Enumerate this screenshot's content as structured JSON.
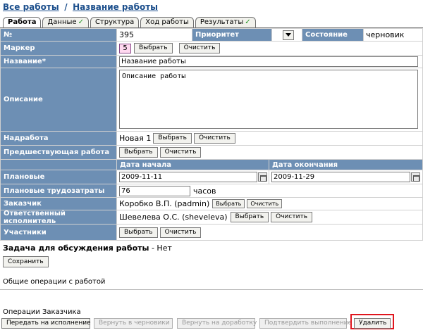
{
  "breadcrumb": {
    "all_works": "Все работы",
    "separator": "/",
    "current": "Название работы"
  },
  "tabs": [
    {
      "label": "Работа",
      "active": true,
      "check": false
    },
    {
      "label": "Данные",
      "active": false,
      "check": true
    },
    {
      "label": "Структура",
      "active": false,
      "check": false
    },
    {
      "label": "Ход работы",
      "active": false,
      "check": false
    },
    {
      "label": "Результаты",
      "active": false,
      "check": true
    }
  ],
  "check_mark": "✓",
  "form": {
    "number": {
      "label": "№",
      "value": "395"
    },
    "priority": {
      "label": "Приоритет",
      "selected": ""
    },
    "state": {
      "label": "Состояние",
      "value": "черновик"
    },
    "marker": {
      "label": "Маркер",
      "value": "5",
      "select": "Выбрать",
      "clear": "Очистить"
    },
    "title": {
      "label": "Название*",
      "value": "Название работы"
    },
    "description": {
      "label": "Описание",
      "value": "Описание работы"
    },
    "parent": {
      "label": "Надработа",
      "value": "Новая 1",
      "select": "Выбрать",
      "clear": "Очистить"
    },
    "previous": {
      "label": "Предшествующая работа",
      "select": "Выбрать",
      "clear": "Очистить"
    },
    "dates": {
      "start_header": "Дата начала",
      "end_header": "Дата окончания"
    },
    "planned": {
      "label": "Плановые",
      "start": "2009-11-11",
      "end": "2009-11-29"
    },
    "effort": {
      "label": "Плановые трудозатраты",
      "value": "76",
      "unit": "часов"
    },
    "customer": {
      "label": "Заказчик",
      "value": "Коробко В.П. (padmin)",
      "select": "Выбрать",
      "clear": "Очистить"
    },
    "executor": {
      "label": "Ответственный исполнитель",
      "value": "Шевелева О.С. (sheveleva)",
      "select": "Выбрать",
      "clear": "Очистить"
    },
    "participants": {
      "label": "Участники",
      "select": "Выбрать",
      "clear": "Очистить"
    }
  },
  "discussion": {
    "label": "Задача для обсуждения работы",
    "value": "- Нет"
  },
  "save": "Сохранить",
  "common_ops": "Общие операции с работой",
  "customer_ops": {
    "title": "Операции Заказчика",
    "buttons": [
      {
        "label": "Передать на исполнение",
        "disabled": false
      },
      {
        "label": "Вернуть в черновики",
        "disabled": true
      },
      {
        "label": "Вернуть на доработку",
        "disabled": true
      },
      {
        "label": "Подтвердить выполнение",
        "disabled": true
      },
      {
        "label": "Удалить",
        "disabled": false,
        "highlighted": true
      }
    ]
  },
  "colors": {
    "label_bg": "#6d8fb4",
    "link": "#1c4f8c",
    "highlight": "#e0161e",
    "marker_bg": "#ffd9f0"
  }
}
